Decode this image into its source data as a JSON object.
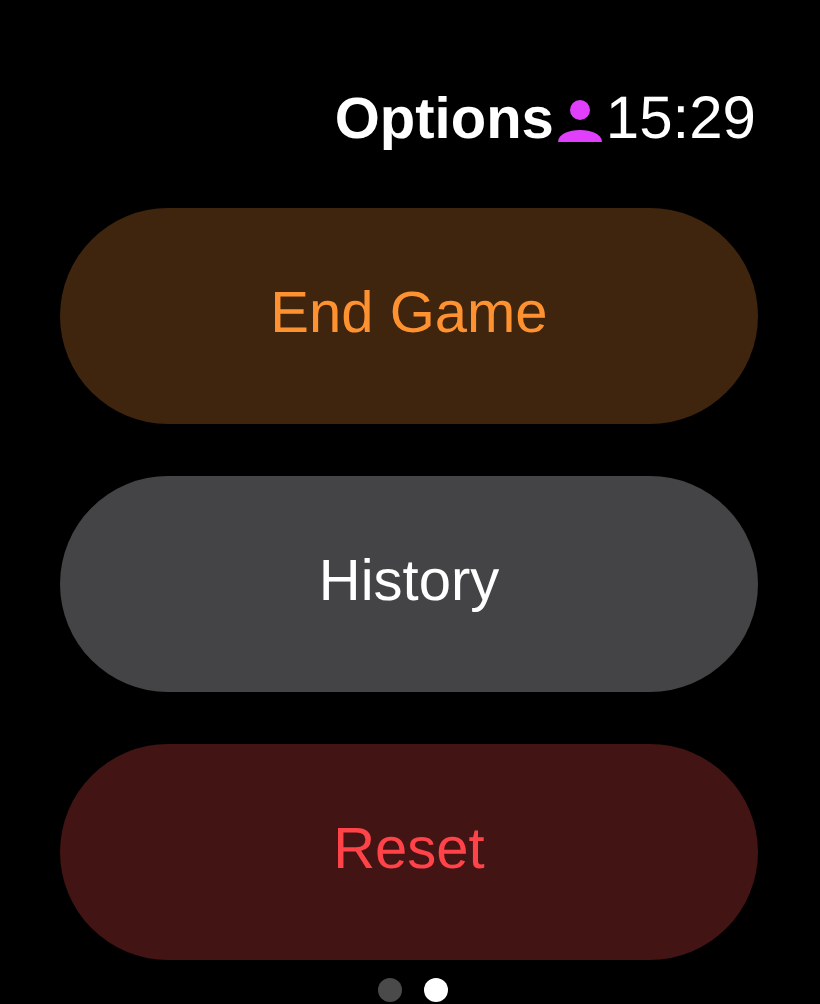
{
  "header": {
    "title": "Options",
    "time": "15:29"
  },
  "buttons": [
    {
      "label": "End Game",
      "kind": "warning"
    },
    {
      "label": "History",
      "kind": "neutral"
    },
    {
      "label": "Reset",
      "kind": "destructive"
    }
  ],
  "pages": [
    {
      "selected": false
    },
    {
      "selected": true
    }
  ]
}
